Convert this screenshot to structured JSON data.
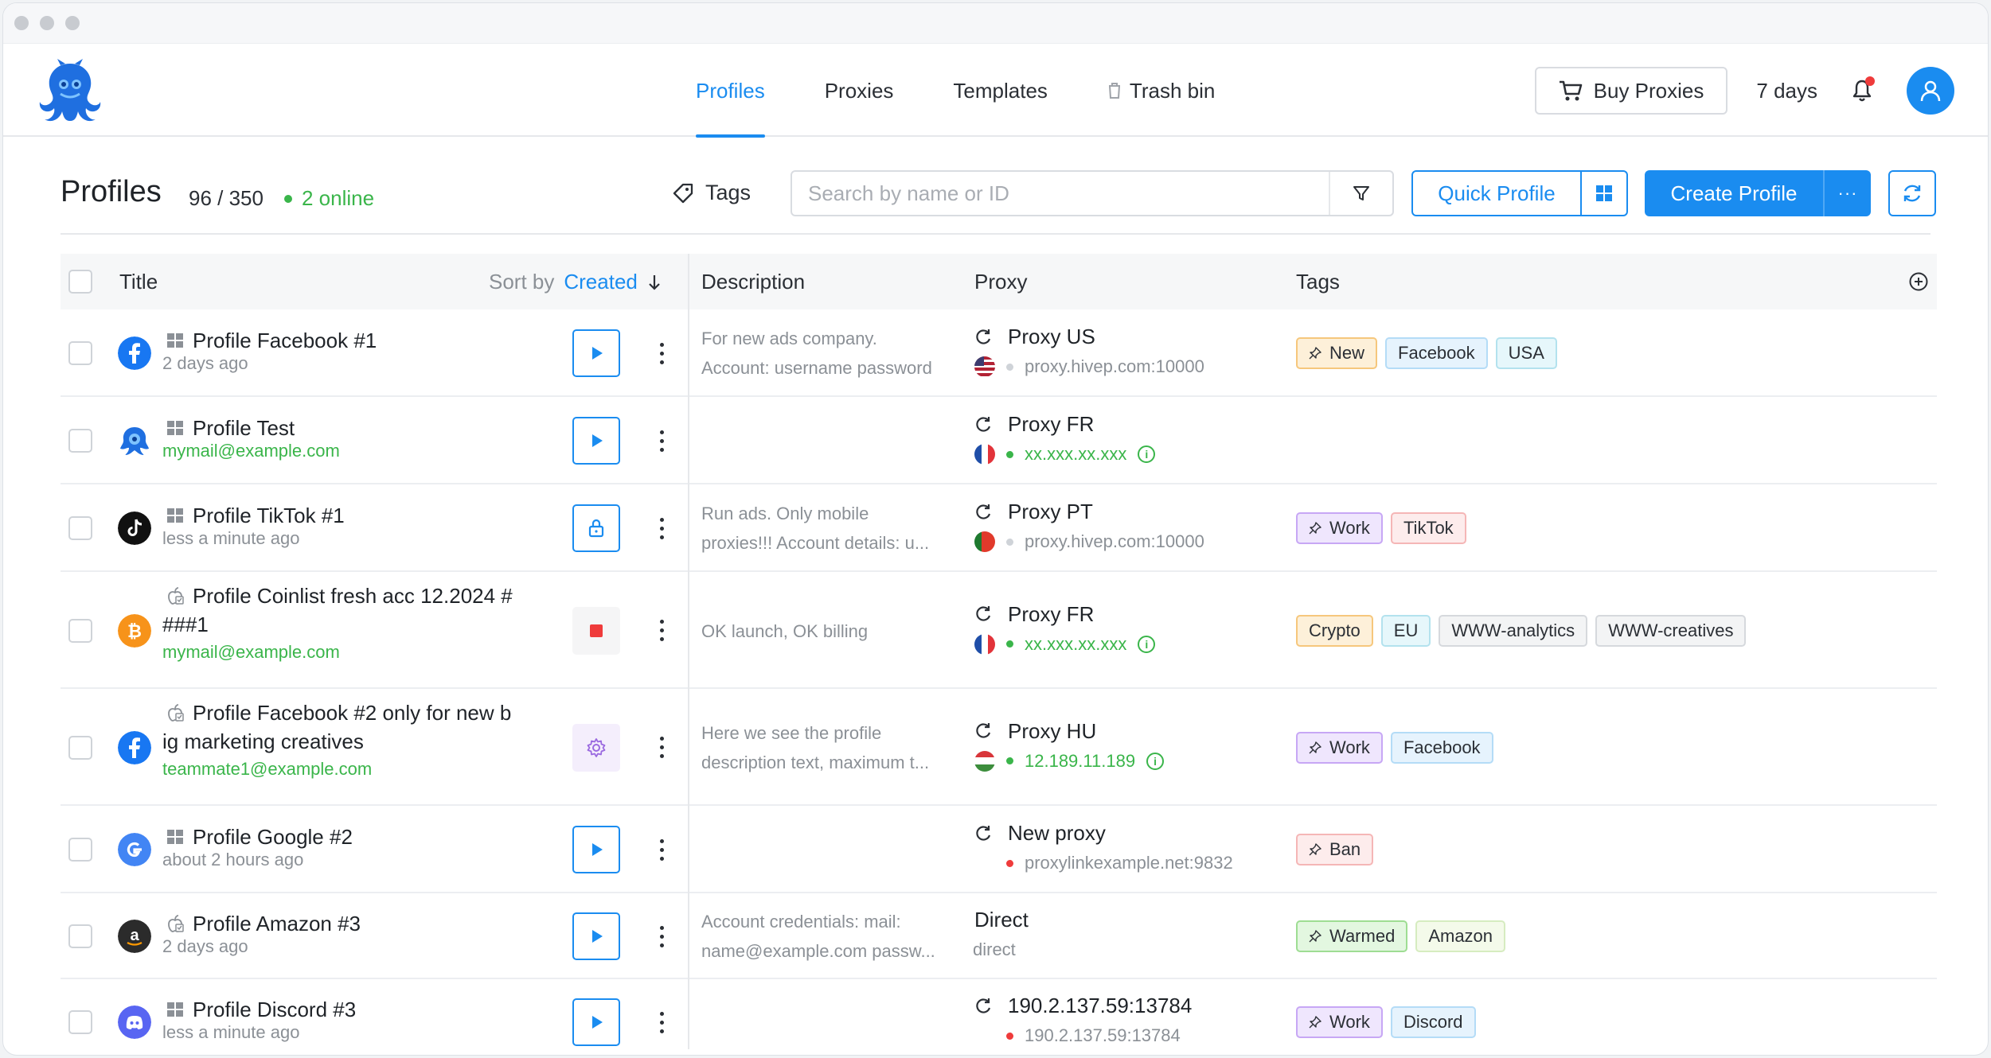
{
  "nav": {
    "tabs": [
      {
        "label": "Profiles"
      },
      {
        "label": "Proxies"
      },
      {
        "label": "Templates"
      },
      {
        "label": "Trash bin"
      }
    ],
    "buy_label": "Buy Proxies",
    "days_label": "7 days"
  },
  "header": {
    "title": "Profiles",
    "count": "96 / 350",
    "online": "2 online",
    "tags_label": "Tags",
    "search_placeholder": "Search by name or ID",
    "quick_label": "Quick Profile",
    "create_label": "Create Profile",
    "create_more": "···"
  },
  "table": {
    "col_title": "Title",
    "sort_label": "Sort by",
    "sort_value": "Created",
    "col_description": "Description",
    "col_proxy": "Proxy",
    "col_tags": "Tags"
  },
  "colors": {
    "accent": "#1a8cf0",
    "online": "#3ab54a",
    "danger": "#ef3b3b"
  },
  "rows": [
    {
      "icon": "facebook-icon",
      "os": "windows-icon",
      "name": "Profile Facebook #1",
      "sub": "2 days ago",
      "sub_green": false,
      "action": "play",
      "desc1": "For new ads company.",
      "desc2": "Account: username password",
      "proxy_title": "Proxy US",
      "proxy_refresh": true,
      "flag": "us",
      "proxy_addr": "proxy.hivep.com:10000",
      "addr_state": "gray",
      "tags": [
        {
          "label": "New",
          "pin": true,
          "color": "orange"
        },
        {
          "label": "Facebook",
          "color": "blue"
        },
        {
          "label": "USA",
          "color": "cyan"
        }
      ]
    },
    {
      "icon": "octo-icon",
      "os": "windows-icon",
      "name": "Profile Test",
      "sub": "mymail@example.com",
      "sub_green": true,
      "action": "play",
      "desc1": "",
      "desc2": "",
      "proxy_title": "Proxy FR",
      "proxy_refresh": true,
      "flag": "fr",
      "proxy_addr": "xx.xxx.xx.xxx",
      "addr_state": "green",
      "info": true,
      "tags": []
    },
    {
      "icon": "tiktok-icon",
      "os": "windows-icon",
      "name": "Profile TikTok #1",
      "sub": "less a minute ago",
      "sub_green": false,
      "action": "lock",
      "desc1": "Run ads. Only mobile",
      "desc2": "proxies!!! Account details: u...",
      "proxy_title": "Proxy PT",
      "proxy_refresh": true,
      "flag": "pt",
      "proxy_addr": "proxy.hivep.com:10000",
      "addr_state": "gray",
      "tags": [
        {
          "label": "Work",
          "pin": true,
          "color": "purple"
        },
        {
          "label": "TikTok",
          "color": "red"
        }
      ]
    },
    {
      "icon": "bitcoin-icon",
      "os": "apple-icon",
      "name": "Profile Coinlist fresh acc 12.2024 #",
      "name2": "###1",
      "sub": "mymail@example.com",
      "sub_green": true,
      "action": "stop",
      "desc1": "OK launch, OK billing",
      "desc2": "",
      "proxy_title": "Proxy FR",
      "proxy_refresh": true,
      "flag": "fr",
      "proxy_addr": "xx.xxx.xx.xxx",
      "addr_state": "green",
      "info": true,
      "tags": [
        {
          "label": "Crypto",
          "color": "orange"
        },
        {
          "label": "EU",
          "color": "cyan"
        },
        {
          "label": "WWW-analytics",
          "color": "gray"
        },
        {
          "label": "WWW-creatives",
          "color": "gray"
        }
      ]
    },
    {
      "icon": "facebook-icon",
      "os": "apple-icon",
      "name": "Profile Facebook #2 only for new b",
      "name2": "ig marketing creatives",
      "sub": "teammate1@example.com",
      "sub_green": true,
      "action": "gear",
      "desc1": "Here we see the profile",
      "desc2": "description text, maximum t...",
      "proxy_title": "Proxy HU",
      "proxy_refresh": true,
      "flag": "hu",
      "proxy_addr": "12.189.11.189",
      "addr_state": "green",
      "info": true,
      "tags": [
        {
          "label": "Work",
          "pin": true,
          "color": "purple"
        },
        {
          "label": "Facebook",
          "color": "blue"
        }
      ]
    },
    {
      "icon": "google-icon",
      "os": "windows-icon",
      "name": "Profile Google #2",
      "sub": "about 2 hours ago",
      "sub_green": false,
      "action": "play",
      "desc1": "",
      "desc2": "",
      "proxy_title": "New proxy",
      "proxy_refresh": true,
      "flag": "",
      "proxy_addr": "proxylinkexample.net:9832",
      "addr_state": "red",
      "tags": [
        {
          "label": "Ban",
          "pin": true,
          "color": "red"
        }
      ]
    },
    {
      "icon": "amazon-icon",
      "os": "apple-icon",
      "name": "Profile Amazon #3",
      "sub": "2 days ago",
      "sub_green": false,
      "action": "play",
      "desc1": "Account credentials: mail:",
      "desc2": "name@example.com passw...",
      "proxy_title": "Direct",
      "proxy_refresh": false,
      "flag": "",
      "proxy_addr": "direct",
      "addr_state": "none",
      "tags": [
        {
          "label": "Warmed",
          "pin": true,
          "color": "green"
        },
        {
          "label": "Amazon",
          "color": "lime"
        }
      ]
    },
    {
      "icon": "discord-icon",
      "os": "windows-icon",
      "name": "Profile Discord #3",
      "sub": "less a minute ago",
      "sub_green": false,
      "action": "play",
      "desc1": "",
      "desc2": "",
      "proxy_title": "190.2.137.59:13784",
      "proxy_refresh": true,
      "flag": "",
      "proxy_addr": "190.2.137.59:13784",
      "addr_state": "red",
      "tags": [
        {
          "label": "Work",
          "pin": true,
          "color": "purple"
        },
        {
          "label": "Discord",
          "color": "blue"
        }
      ]
    }
  ]
}
